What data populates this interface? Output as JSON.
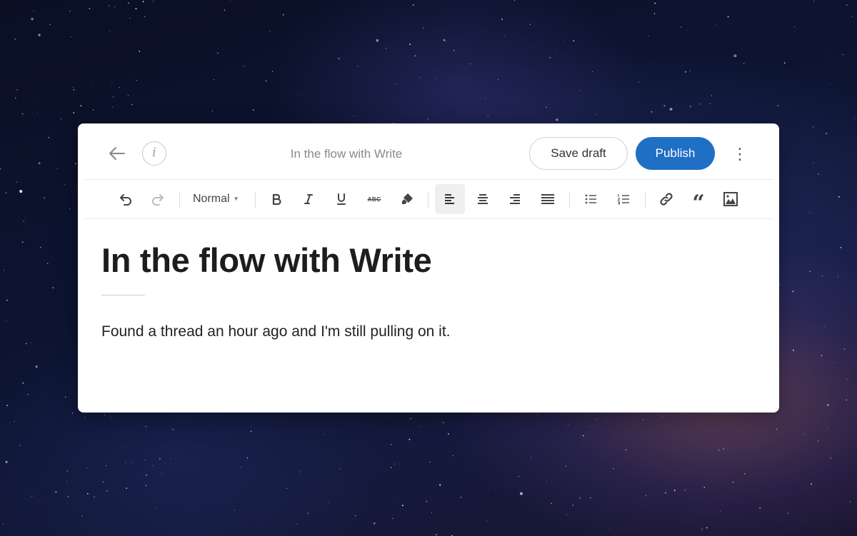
{
  "header": {
    "doc_title": "In the flow with Write",
    "info_label": "i",
    "save_label": "Save draft",
    "publish_label": "Publish",
    "more_label": "⋮"
  },
  "toolbar": {
    "block_style": "Normal",
    "strikethrough_label": "ABC",
    "quote_label": "“"
  },
  "content": {
    "title": "In the flow with Write",
    "body": "Found a thread an hour ago and I'm still pulling on it."
  },
  "colors": {
    "accent": "#1f6fc5"
  },
  "icons": [
    "arrow-left-icon",
    "info-icon",
    "undo-icon",
    "redo-icon",
    "bold-icon",
    "italic-icon",
    "underline-icon",
    "strikethrough-icon",
    "highlighter-icon",
    "align-left-icon",
    "align-center-icon",
    "align-right-icon",
    "align-justify-icon",
    "bullet-list-icon",
    "numbered-list-icon",
    "link-icon",
    "quote-icon",
    "image-icon",
    "more-vertical-icon"
  ]
}
